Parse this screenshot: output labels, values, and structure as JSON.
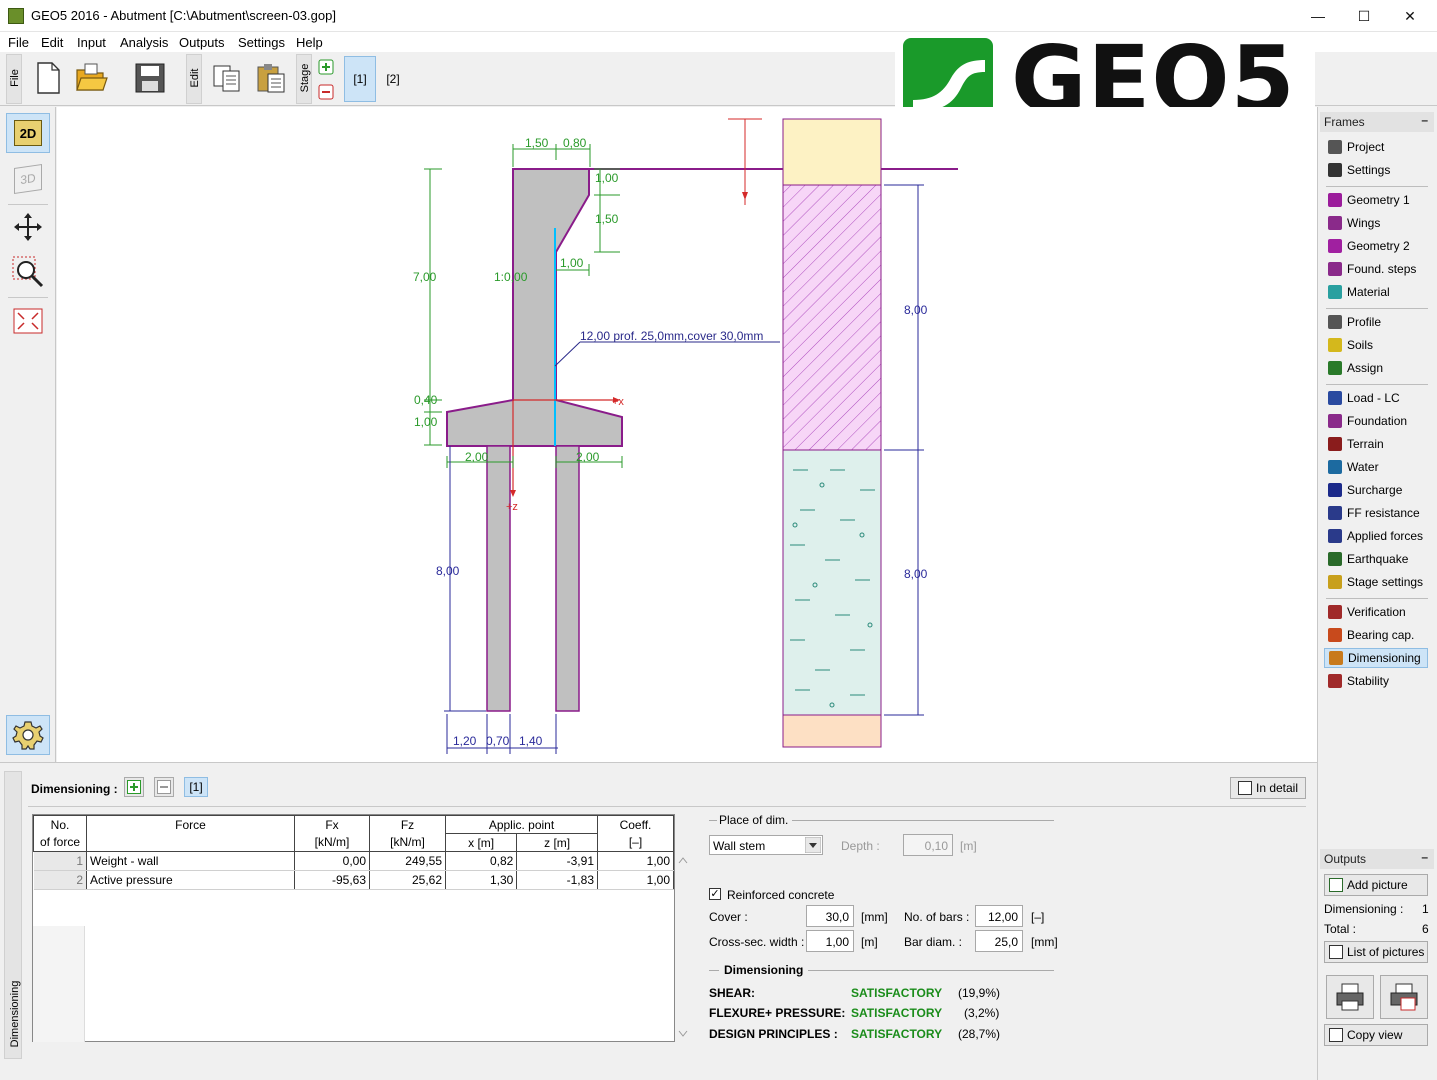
{
  "window": {
    "title": "GEO5 2016 - Abutment [C:\\Abutment\\screen-03.gop]",
    "minimize": "—",
    "maximize": "☐",
    "close": "✕"
  },
  "menu": [
    "File",
    "Edit",
    "Input",
    "Analysis",
    "Outputs",
    "Settings",
    "Help"
  ],
  "toolbar": {
    "file_label": "File",
    "edit_label": "Edit",
    "stage_label": "Stage",
    "stages": [
      "[1]",
      "[2]"
    ]
  },
  "logo": {
    "word": "GEO5"
  },
  "left_tools": {
    "mode_2d": "2D",
    "mode_3d": "3D"
  },
  "drawing": {
    "dims": {
      "top_w1": "1,50",
      "top_w2": "0,80",
      "h_100": "1,00",
      "h_150": "1,50",
      "offset_100": "1,00",
      "h_700": "7,00",
      "batter": "1:0,00",
      "h_040": "0,40",
      "h_100b": "1,00",
      "w_200_left": "2,00",
      "w_200_right": "2,00",
      "pile_len": "8,00",
      "b_120": "1,20",
      "b_070": "0,70",
      "b_140": "1,40",
      "soil_800_top": "8,00",
      "soil_800_bot": "8,00"
    },
    "reinforcement_label": "12,00 prof. 25,0mm,cover 30,0mm",
    "axis_x": "+x",
    "axis_z": "+z"
  },
  "frames": {
    "header": "Frames",
    "minimize": "–",
    "groups": [
      [
        {
          "label": "Project",
          "color": "#555"
        },
        {
          "label": "Settings",
          "color": "#333"
        }
      ],
      [
        {
          "label": "Geometry 1",
          "color": "#9b1c9b"
        },
        {
          "label": "Wings",
          "color": "#8a2a8a"
        },
        {
          "label": "Geometry 2",
          "color": "#a020a0"
        },
        {
          "label": "Found. steps",
          "color": "#8a2a8a"
        },
        {
          "label": "Material",
          "color": "#2aa0a0"
        }
      ],
      [
        {
          "label": "Profile",
          "color": "#555"
        },
        {
          "label": "Soils",
          "color": "#d4b81c"
        },
        {
          "label": "Assign",
          "color": "#2a7a2a"
        }
      ],
      [
        {
          "label": "Load - LC",
          "color": "#2a4aa0"
        },
        {
          "label": "Foundation",
          "color": "#8a2a8a"
        },
        {
          "label": "Terrain",
          "color": "#8a1c1c"
        },
        {
          "label": "Water",
          "color": "#1c6aa0"
        },
        {
          "label": "Surcharge",
          "color": "#1c2a8a"
        },
        {
          "label": "FF resistance",
          "color": "#2a3a8a"
        },
        {
          "label": "Applied forces",
          "color": "#2a3a8a"
        },
        {
          "label": "Earthquake",
          "color": "#2a6a2a"
        },
        {
          "label": "Stage settings",
          "color": "#c8a01c"
        }
      ],
      [
        {
          "label": "Verification",
          "color": "#a02a2a"
        },
        {
          "label": "Bearing cap.",
          "color": "#c84a1c"
        },
        {
          "label": "Dimensioning",
          "color": "#c87a1c",
          "active": true
        },
        {
          "label": "Stability",
          "color": "#a02a2a"
        }
      ]
    ]
  },
  "outputs": {
    "header": "Outputs",
    "minimize": "–",
    "add_picture": "Add picture",
    "dimensioning_label": "Dimensioning :",
    "dimensioning_count": "1",
    "total_label": "Total :",
    "total_count": "6",
    "list_of_pictures": "List of pictures",
    "copy_view": "Copy view"
  },
  "bottom": {
    "side_label": "Dimensioning",
    "title": "Dimensioning :",
    "stage_tag": "[1]",
    "in_detail": "In detail",
    "table": {
      "headers": {
        "no": "No.",
        "no_sub": "of force",
        "force": "Force",
        "fx": "Fx",
        "fx_unit": "[kN/m]",
        "fz": "Fz",
        "fz_unit": "[kN/m]",
        "applic": "Applic. point",
        "x": "x [m]",
        "z": "z [m]",
        "coeff": "Coeff.",
        "coeff_unit": "[–]"
      },
      "rows": [
        {
          "no": "1",
          "force": "Weight - wall",
          "fx": "0,00",
          "fz": "249,55",
          "x": "0,82",
          "z": "-3,91",
          "coeff": "1,00"
        },
        {
          "no": "2",
          "force": "Active pressure",
          "fx": "-95,63",
          "fz": "25,62",
          "x": "1,30",
          "z": "-1,83",
          "coeff": "1,00"
        }
      ]
    },
    "place_of_dim": "Place of dim.",
    "place_value": "Wall stem",
    "depth_label": "Depth :",
    "depth_value": "0,10",
    "depth_unit": "[m]",
    "reinforced_label": "Reinforced concrete",
    "cover_label": "Cover :",
    "cover_value": "30,0",
    "cover_unit": "[mm]",
    "bars_label": "No. of bars :",
    "bars_value": "12,00",
    "bars_unit": "[–]",
    "width_label": "Cross-sec. width :",
    "width_value": "1,00",
    "width_unit": "[m]",
    "diam_label": "Bar diam. :",
    "diam_value": "25,0",
    "diam_unit": "[mm]",
    "results_title": "Dimensioning",
    "results": [
      {
        "name": "SHEAR:",
        "status": "SATISFACTORY",
        "pct": "(19,9%)"
      },
      {
        "name": "FLEXURE+ PRESSURE:",
        "status": "SATISFACTORY",
        "pct": "(3,2%)"
      },
      {
        "name": "DESIGN PRINCIPLES :",
        "status": "SATISFACTORY",
        "pct": "(28,7%)"
      }
    ]
  }
}
